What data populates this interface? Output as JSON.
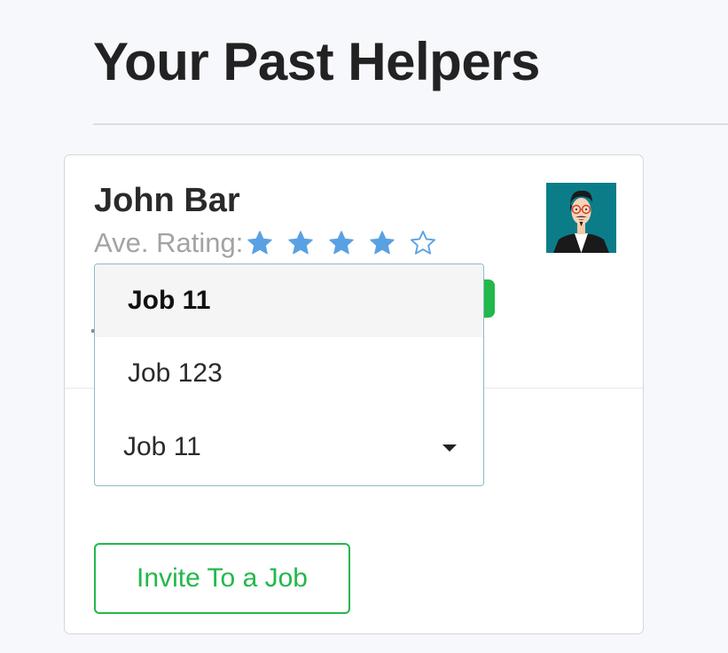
{
  "page": {
    "title": "Your Past Helpers"
  },
  "helper_card": {
    "name": "John Bar",
    "rating_label": "Ave. Rating:",
    "rating": {
      "value": 4,
      "max": 5,
      "filled_icon": "star-filled-icon",
      "empty_icon": "star-outline-icon"
    },
    "avatar_icon": "person-with-glasses-avatar",
    "job_select": {
      "options": [
        "Job 11",
        "Job 123"
      ],
      "highlighted_option": "Job 11",
      "selected_value": "Job 11",
      "caret_icon": "caret-down-icon"
    },
    "invite_button_label": "Invite To a Job"
  },
  "colors": {
    "accent_green": "#22b84b",
    "star_blue": "#5aa1e3",
    "title_text": "#222222",
    "muted_text": "#a3a3a3",
    "background": "#f7f8fc",
    "dropdown_border": "#8fb8c9"
  }
}
